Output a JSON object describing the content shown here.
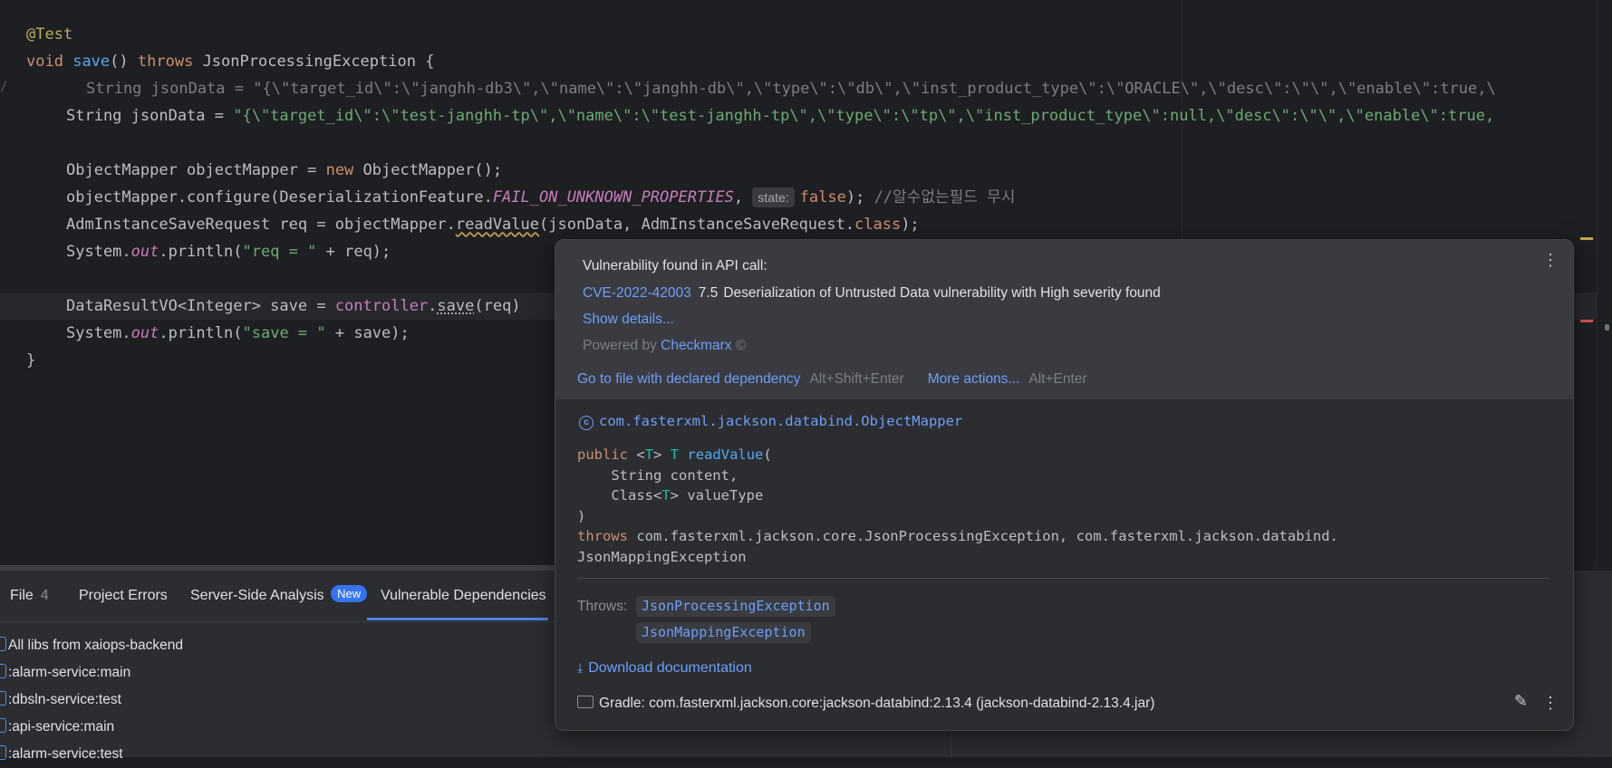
{
  "editor": {
    "annotation": "@Test",
    "method_signature": {
      "void": "void",
      "name": "save",
      "parens": "()",
      "throws": "throws",
      "exception": "JsonProcessingException {"
    },
    "commented_line": {
      "prefix": "String jsonData = ",
      "value": "\"{\\\"target_id\\\":\\\"janghh-db3\\\",\\\"name\\\":\\\"janghh-db\\\",\\\"type\\\":\\\"db\\\",\\\"inst_product_type\\\":\\\"ORACLE\\\",\\\"desc\\\":\\\"\\\",\\\"enable\\\":true,\\"
    },
    "json_line": {
      "prefix": "String jsonData = ",
      "value": "\"{\\\"target_id\\\":\\\"test-janghh-tp\\\",\\\"name\\\":\\\"test-janghh-tp\\\",\\\"type\\\":\\\"tp\\\",\\\"inst_product_type\\\":null,\\\"desc\\\":\\\"\\\",\\\"enable\\\":true,"
    },
    "mapper_line": {
      "a": "ObjectMapper objectMapper = ",
      "new": "new",
      "b": " ObjectMapper();"
    },
    "configure_line": {
      "a": "objectMapper.configure(DeserializationFeature.",
      "const": "FAIL_ON_UNKNOWN_PROPERTIES",
      "comma": ", ",
      "hint": "state:",
      "false": "false",
      "close": ");",
      "comment": " //알수없는필드 무시"
    },
    "req_line": {
      "a": "AdmInstanceSaveRequest req = objectMapper.",
      "method": "readValue",
      "b": "(jsonData, AdmInstanceSaveRequest.",
      "class": "class",
      "c": ");"
    },
    "println1": {
      "a": "System.",
      "out": "out",
      "b": ".println(",
      "str": "\"req = \"",
      "c": " + req);"
    },
    "save_line": {
      "a": "DataResultVO<Integer> save = ",
      "controller": "controller",
      "dot": ".",
      "method": "save",
      "b": "(req)"
    },
    "println2": {
      "a": "System.",
      "out": "out",
      "b": ".println(",
      "str": "\"save = \"",
      "c": " + save);"
    },
    "close_brace": "}"
  },
  "tool_window": {
    "tabs": [
      {
        "label": "File",
        "count": "4"
      },
      {
        "label": "Project Errors"
      },
      {
        "label": "Server-Side Analysis",
        "badge": "New"
      },
      {
        "label": "Vulnerable Dependencies"
      }
    ],
    "tree": [
      "All libs from xaiops-backend",
      ":alarm-service:main",
      ":dbsln-service:test",
      ":api-service:main",
      ":alarm-service:test"
    ]
  },
  "popup": {
    "title": "Vulnerability found in API call:",
    "cve_id": "CVE-2022-42003",
    "score": "7.5",
    "description": "Deserialization of Untrusted Data vulnerability with High severity found",
    "show_details": "Show details...",
    "powered_by": "Powered by",
    "checkmarx": "Checkmarx",
    "copyright": "©",
    "goto_file": "Go to file with declared dependency",
    "goto_shortcut": "Alt+Shift+Enter",
    "more_actions": "More actions...",
    "more_shortcut": "Alt+Enter",
    "class_fqn": "com.fasterxml.jackson.databind.ObjectMapper",
    "sig": {
      "public": "public",
      "generic_open": "<",
      "t": "T",
      "generic_close": ">",
      "ret_t": "T",
      "method": "readValue",
      "open": "(",
      "param1": "    String content,",
      "param2_a": "    Class<",
      "param2_t": "T",
      "param2_b": "> valueType",
      "close": ")",
      "throws": "throws",
      "throws_list": "com.fasterxml.jackson.core.JsonProcessingException, com.fasterxml.jackson.databind.",
      "throws_cont": "JsonMappingException"
    },
    "throws_label": "Throws:",
    "throws_chips": [
      "JsonProcessingException",
      "JsonMappingException"
    ],
    "download_doc": "Download documentation",
    "gradle": "Gradle: com.fasterxml.jackson.core:jackson-databind:2.13.4 (jackson-databind-2.13.4.jar)"
  },
  "colors": {
    "editor_bg": "#1e1f22",
    "panel_bg": "#2b2d30",
    "popup_top_bg": "#393b40",
    "link": "#6f9ef8",
    "keyword": "#cf8e6d",
    "string": "#6aab73"
  }
}
